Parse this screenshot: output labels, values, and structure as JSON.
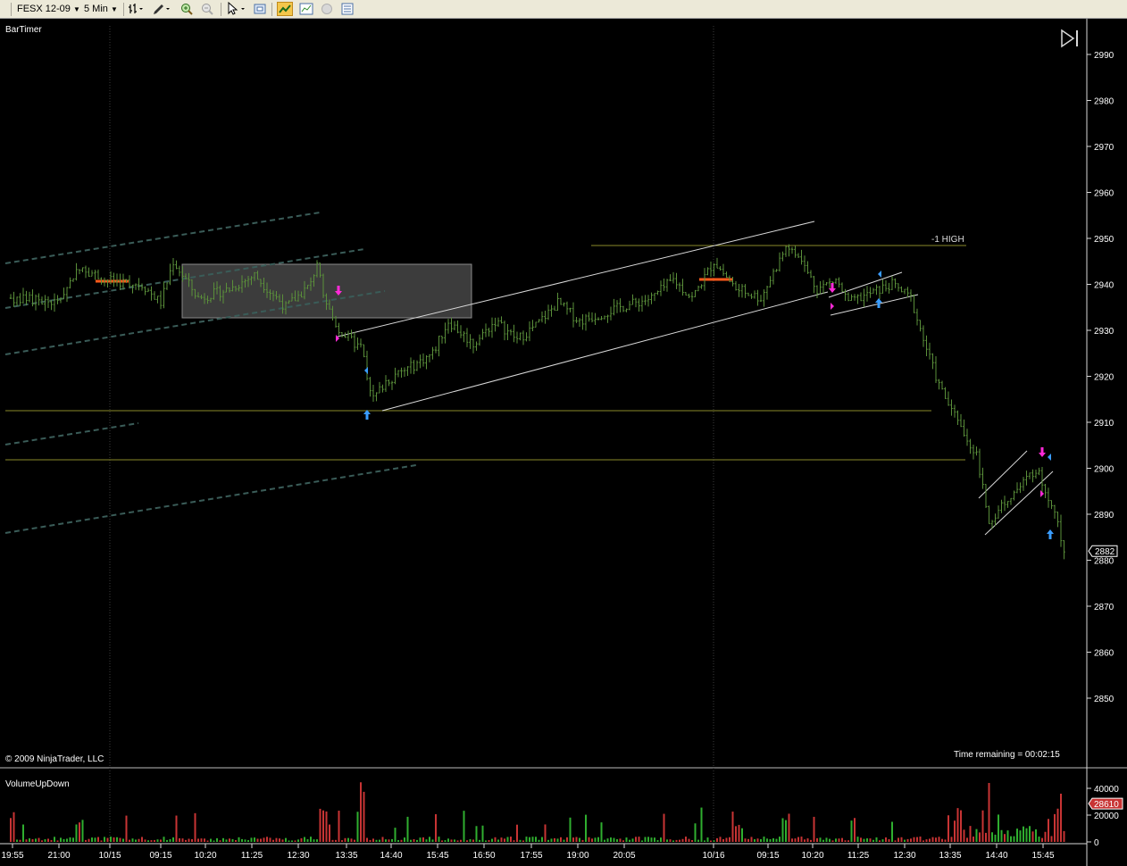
{
  "toolbar": {
    "instrument": "FESX 12-09",
    "interval": "5 Min"
  },
  "chart_data": {
    "type": "candlestick",
    "indicator_top": "BarTimer",
    "indicator_bottom": "VolumeUpDown",
    "copyright": "© 2009 NinjaTrader, LLC",
    "time_remaining": "Time remaining = 00:02:15",
    "annotation": "-1 HIGH",
    "last_price": "2882",
    "last_volume": "28610",
    "price_ticks": [
      "2990",
      "2980",
      "2970",
      "2960",
      "2950",
      "2940",
      "2930",
      "2920",
      "2910",
      "2900",
      "2890",
      "2880",
      "2870",
      "2860",
      "2850"
    ],
    "volume_ticks": [
      "40000",
      "20000",
      "0"
    ],
    "time_ticks": [
      "19:55",
      "21:00",
      "10/15",
      "09:15",
      "10:20",
      "11:25",
      "12:30",
      "13:35",
      "14:40",
      "15:45",
      "16:50",
      "17:55",
      "19:00",
      "20:05",
      "10/16",
      "09:15",
      "10:20",
      "11:25",
      "12:30",
      "13:35",
      "14:40",
      "15:45"
    ],
    "ylim": [
      2840,
      2995
    ],
    "volume_ylim": [
      0,
      45000
    ],
    "anchors": [
      {
        "bar": 0,
        "price": 2937
      },
      {
        "bar": 15,
        "price": 2936
      },
      {
        "bar": 22,
        "price": 2944
      },
      {
        "bar": 30,
        "price": 2941
      },
      {
        "bar": 42,
        "price": 2940
      },
      {
        "bar": 48,
        "price": 2936
      },
      {
        "bar": 52,
        "price": 2945
      },
      {
        "bar": 60,
        "price": 2937
      },
      {
        "bar": 70,
        "price": 2939
      },
      {
        "bar": 78,
        "price": 2942
      },
      {
        "bar": 88,
        "price": 2935
      },
      {
        "bar": 96,
        "price": 2940
      },
      {
        "bar": 98,
        "price": 2945
      },
      {
        "bar": 100,
        "price": 2937
      },
      {
        "bar": 105,
        "price": 2930
      },
      {
        "bar": 112,
        "price": 2926
      },
      {
        "bar": 116,
        "price": 2915
      },
      {
        "bar": 120,
        "price": 2919
      },
      {
        "bar": 128,
        "price": 2922
      },
      {
        "bar": 135,
        "price": 2925
      },
      {
        "bar": 140,
        "price": 2932
      },
      {
        "bar": 148,
        "price": 2927
      },
      {
        "bar": 155,
        "price": 2932
      },
      {
        "bar": 162,
        "price": 2928
      },
      {
        "bar": 168,
        "price": 2931
      },
      {
        "bar": 175,
        "price": 2936
      },
      {
        "bar": 182,
        "price": 2932
      },
      {
        "bar": 195,
        "price": 2935
      },
      {
        "bar": 205,
        "price": 2937
      },
      {
        "bar": 212,
        "price": 2941
      },
      {
        "bar": 218,
        "price": 2937
      },
      {
        "bar": 225,
        "price": 2945
      },
      {
        "bar": 232,
        "price": 2939
      },
      {
        "bar": 240,
        "price": 2937
      },
      {
        "bar": 248,
        "price": 2948
      },
      {
        "bar": 252,
        "price": 2946
      },
      {
        "bar": 258,
        "price": 2939
      },
      {
        "bar": 264,
        "price": 2941
      },
      {
        "bar": 268,
        "price": 2936
      },
      {
        "bar": 275,
        "price": 2938
      },
      {
        "bar": 282,
        "price": 2940
      },
      {
        "bar": 288,
        "price": 2937
      },
      {
        "bar": 292,
        "price": 2928
      },
      {
        "bar": 297,
        "price": 2918
      },
      {
        "bar": 303,
        "price": 2910
      },
      {
        "bar": 309,
        "price": 2903
      },
      {
        "bar": 313,
        "price": 2888
      },
      {
        "bar": 318,
        "price": 2893
      },
      {
        "bar": 323,
        "price": 2896
      },
      {
        "bar": 328,
        "price": 2900
      },
      {
        "bar": 332,
        "price": 2894
      },
      {
        "bar": 335,
        "price": 2888
      },
      {
        "bar": 337,
        "price": 2882
      }
    ],
    "colors": {
      "background": "#000000",
      "bar": "#5a8f3a",
      "volume_up": "#2fae2f",
      "volume_down": "#c83434",
      "channel": "#d8d8d8",
      "dashed_channel": "#3a5c58",
      "horizontal": "#8a8a2a",
      "pivot": "#ff5a1a",
      "buy_arrow": "#3a9dff",
      "sell_arrow": "#ff2ad8",
      "grid_vertical": "#3c3c3c"
    }
  }
}
